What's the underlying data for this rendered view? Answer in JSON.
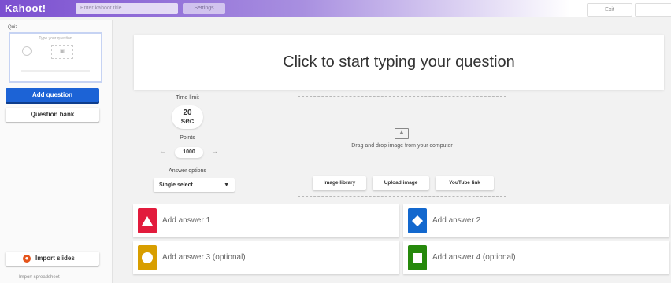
{
  "topbar": {
    "logo": "Kahoot!",
    "title_placeholder": "Enter kahoot title...",
    "settings_label": "Settings",
    "exit_label": "Exit",
    "gradient_colors": [
      "#7b4fd0",
      "#a88fe0",
      "#ffffff"
    ]
  },
  "sidebar": {
    "slide_type_label": "Quiz",
    "thumb_title": "Type your question",
    "add_question_label": "Add question",
    "question_bank_label": "Question bank",
    "import_slides_label": "Import slides",
    "import_spreadsheet_label": "Import spreadsheet",
    "accent_color": "#1c63d6"
  },
  "question": {
    "placeholder": "Click to start typing your question"
  },
  "settings": {
    "time_limit_label": "Time limit",
    "time_limit_value": "20",
    "time_limit_unit": "sec",
    "points_label": "Points",
    "points_value": "1000",
    "answer_options_label": "Answer options",
    "answer_options_value": "Single select"
  },
  "media": {
    "drag_text": "Drag and drop image from your computer",
    "image_library_label": "Image library",
    "upload_image_label": "Upload image",
    "youtube_label": "YouTube link"
  },
  "answers": [
    {
      "label": "Add answer 1",
      "color": "#e21b3c",
      "shape": "triangle-icon"
    },
    {
      "label": "Add answer 2",
      "color": "#1368ce",
      "shape": "diamond-icon"
    },
    {
      "label": "Add answer 3 (optional)",
      "color": "#d89e00",
      "shape": "circle-icon"
    },
    {
      "label": "Add answer 4 (optional)",
      "color": "#26890c",
      "shape": "square-icon"
    }
  ]
}
